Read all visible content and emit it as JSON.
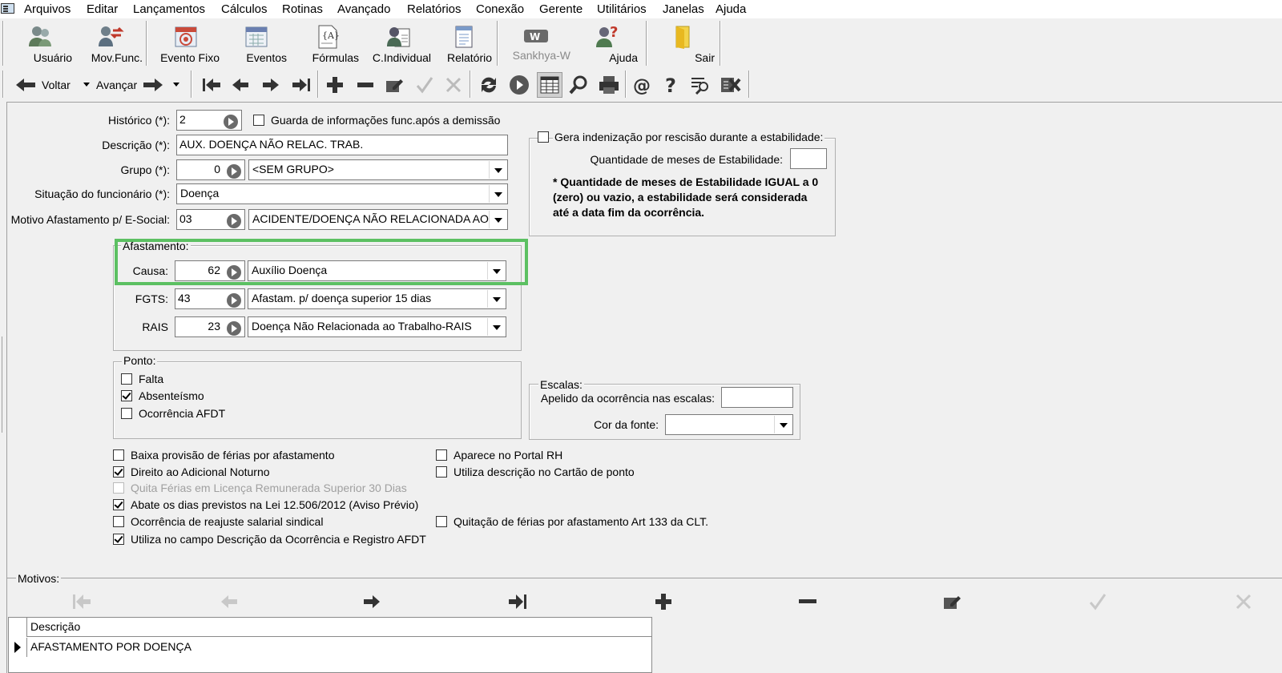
{
  "menu": [
    "Arquivos",
    "Editar",
    "Lançamentos",
    "Cálculos",
    "Rotinas",
    "Avançado",
    "Relatórios",
    "Conexão",
    "Gerente",
    "Utilitários",
    "Janelas",
    "Ajuda"
  ],
  "toolbar": {
    "usuario": "Usuário",
    "mov_func": "Mov.Func.",
    "evento_fixo": "Evento Fixo",
    "eventos": "Eventos",
    "formulas": "Fórmulas",
    "c_individual": "C.Individual",
    "relatorio": "Relatório",
    "sankhya_w": "Sankhya-W",
    "ajuda": "Ajuda",
    "sair": "Sair"
  },
  "nav": {
    "voltar": "Voltar",
    "avancar": "Avançar"
  },
  "form": {
    "historico_label": "Histórico (*):",
    "historico_value": "2",
    "guarda_label": "Guarda de informações func.após a demissão",
    "guarda_checked": false,
    "descricao_label": "Descrição (*):",
    "descricao_value": "AUX. DOENÇA NÃO RELAC. TRAB.",
    "grupo_label": "Grupo (*):",
    "grupo_code": "0",
    "grupo_value": "<SEM GRUPO>",
    "situacao_label": "Situação do funcionário (*):",
    "situacao_value": "Doença",
    "motivo_label": "Motivo Afastamento p/ E-Social:",
    "motivo_code": "03",
    "motivo_value": "ACIDENTE/DOENÇA NÃO RELACIONADA AO T"
  },
  "estabilidade": {
    "gera_label": "Gera indenização por rescisão durante a estabilidade:",
    "gera_checked": false,
    "meses_label": "Quantidade de meses de Estabilidade:",
    "meses_value": "",
    "note": "* Quantidade de meses de Estabilidade IGUAL a 0 (zero) ou vazio, a estabilidade será considerada até a data fim da ocorrência."
  },
  "afastamento": {
    "title": "Afastamento:",
    "causa_label": "Causa:",
    "causa_code": "62",
    "causa_value": "Auxílio Doença",
    "fgts_label": "FGTS:",
    "fgts_code": "43",
    "fgts_value": "Afastam. p/ doença superior 15 dias",
    "rais_label": "RAIS",
    "rais_code": "23",
    "rais_value": "Doença Não Relacionada ao Trabalho-RAIS"
  },
  "ponto": {
    "title": "Ponto:",
    "items": [
      {
        "label": "Falta",
        "checked": false
      },
      {
        "label": "Absenteísmo",
        "checked": true
      },
      {
        "label": "Ocorrência AFDT",
        "checked": false
      }
    ]
  },
  "escalas": {
    "title": "Escalas:",
    "apelido_label": "Apelido da ocorrência nas escalas:",
    "apelido_value": "",
    "cor_label": "Cor da fonte:",
    "cor_value": ""
  },
  "options_left": [
    {
      "label": "Baixa provisão de férias por afastamento",
      "checked": false,
      "disabled": false
    },
    {
      "label": "Direito ao Adicional Noturno",
      "checked": true,
      "disabled": false
    },
    {
      "label": "Quita Férias em Licença Remunerada Superior 30 Dias",
      "checked": false,
      "disabled": true
    },
    {
      "label": "Abate os dias previstos na Lei 12.506/2012 (Aviso Prévio)",
      "checked": true,
      "disabled": false
    },
    {
      "label": "Ocorrência de reajuste salarial sindical",
      "checked": false,
      "disabled": false
    },
    {
      "label": "Utiliza no campo Descrição da Ocorrência e Registro AFDT",
      "checked": true,
      "disabled": false
    }
  ],
  "options_right": [
    {
      "label": "Aparece no Portal RH",
      "checked": false
    },
    {
      "label": "Utiliza descrição no Cartão de ponto",
      "checked": false
    },
    {
      "label": "Quitação de férias por afastamento Art 133 da CLT.",
      "checked": false
    }
  ],
  "motivos": {
    "title": "Motivos:",
    "column": "Descrição",
    "rows": [
      "AFASTAMENTO POR DOENÇA"
    ]
  },
  "colors": {
    "highlight": "#5cc062"
  }
}
